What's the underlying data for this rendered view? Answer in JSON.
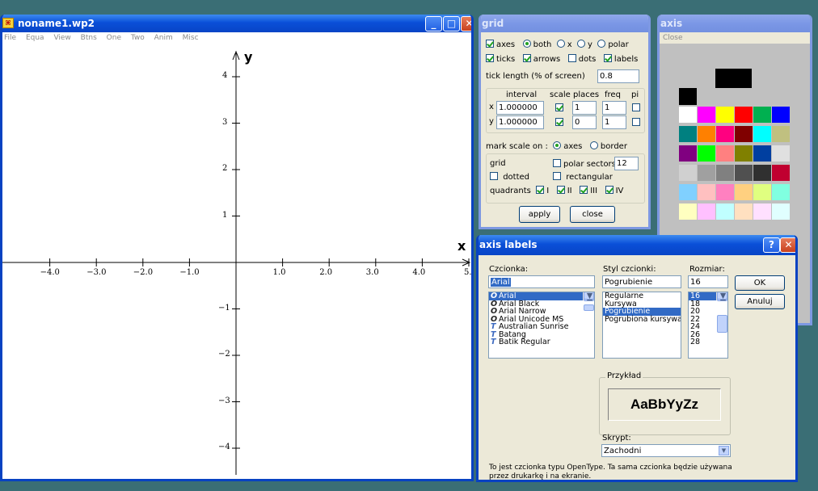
{
  "main_window": {
    "title": "noname1.wp2",
    "menu": [
      "File",
      "Equa",
      "View",
      "Btns",
      "One",
      "Two",
      "Anim",
      "Misc"
    ],
    "controls": {
      "minimize": "_",
      "maximize": "□",
      "close": "✕"
    }
  },
  "plot": {
    "x_label": "x",
    "y_label": "y",
    "x_ticks": [
      "−4.0",
      "−3.0",
      "−2.0",
      "−1.0",
      "1.0",
      "2.0",
      "3.0",
      "4.0",
      "5."
    ],
    "y_ticks": [
      "4",
      "3",
      "2",
      "1",
      "−1",
      "−2",
      "−3",
      "−4"
    ]
  },
  "grid_window": {
    "title": "grid",
    "axes": "axes",
    "both": "both",
    "x": "x",
    "y": "y",
    "polar": "polar",
    "ticks": "ticks",
    "arrows": "arrows",
    "dots": "dots",
    "labels": "labels",
    "tick_length_label": "tick length (% of screen)",
    "tick_length": "0.8",
    "col_interval": "interval",
    "col_scale": "scale",
    "col_places": "places",
    "col_freq": "freq",
    "col_pi": "pi",
    "row_x": "x",
    "x_interval": "1.000000",
    "x_places": "1",
    "x_freq": "1",
    "row_y": "y",
    "y_interval": "1.000000",
    "y_places": "0",
    "y_freq": "1",
    "mark_scale_label": "mark scale on :",
    "mark_axes": "axes",
    "mark_border": "border",
    "grid_label": "grid",
    "polar_sectors_label": "polar sectors",
    "polar_sectors": "12",
    "dotted": "dotted",
    "rectangular": "rectangular",
    "quadrants": "quadrants",
    "q1": "I",
    "q2": "II",
    "q3": "III",
    "q4": "IV",
    "apply": "apply",
    "close": "close"
  },
  "axis_window": {
    "title": "axis",
    "close": "Close",
    "swatch_colors": [
      [
        "#ffffff",
        "#ff00ff",
        "#ffff00",
        "#ff0000",
        "#00b050",
        "#0000ff"
      ],
      [
        "#008080",
        "#ff8000",
        "#ff0080",
        "#800000",
        "#00ffff",
        "#c0c080"
      ],
      [
        "#800080",
        "#00ff00",
        "#ff8080",
        "#808000",
        "#003fa0",
        "#e0e0e0"
      ],
      [
        "#d0d0d0",
        "#a0a0a0",
        "#808080",
        "#505050",
        "#303030",
        "#c00030"
      ],
      [
        "#80d0ff",
        "#ffc0c0",
        "#ff80c0",
        "#ffd080",
        "#e0ff80",
        "#80ffe0"
      ],
      [
        "#ffffc0",
        "#ffc0ff",
        "#c0ffff",
        "#ffe0c0",
        "#ffe0ff",
        "#e0ffff"
      ]
    ]
  },
  "font_dialog": {
    "title": "axis labels",
    "help": "?",
    "close": "✕",
    "font_label": "Czcionka:",
    "font_value": "Arial",
    "fonts": [
      "Arial",
      "Arial Black",
      "Arial Narrow",
      "Arial Unicode MS",
      "Australian Sunrise",
      "Batang",
      "Batik Regular"
    ],
    "font_icons": [
      "O",
      "O",
      "O",
      "O",
      "T",
      "T",
      "T"
    ],
    "style_label": "Styl czcionki:",
    "style_value": "Pogrubienie",
    "styles": [
      "Regularne",
      "Kursywa",
      "Pogrubienie",
      "Pogrubiona kursywa"
    ],
    "size_label": "Rozmiar:",
    "size_value": "16",
    "sizes": [
      "16",
      "18",
      "20",
      "22",
      "24",
      "26",
      "28"
    ],
    "ok": "OK",
    "cancel": "Anuluj",
    "sample_label": "Przykład",
    "sample_text": "AaBbYyZz",
    "script_label": "Skrypt:",
    "script_value": "Zachodni",
    "info": "To jest czcionka typu OpenType. Ta sama czcionka będzie używana przez drukarkę i na ekranie."
  },
  "colors": {
    "title_active": "#0a4fd8",
    "title_inactive": "#7b97e6",
    "panel": "#ece9d8",
    "desktop": "#3a6e75"
  }
}
